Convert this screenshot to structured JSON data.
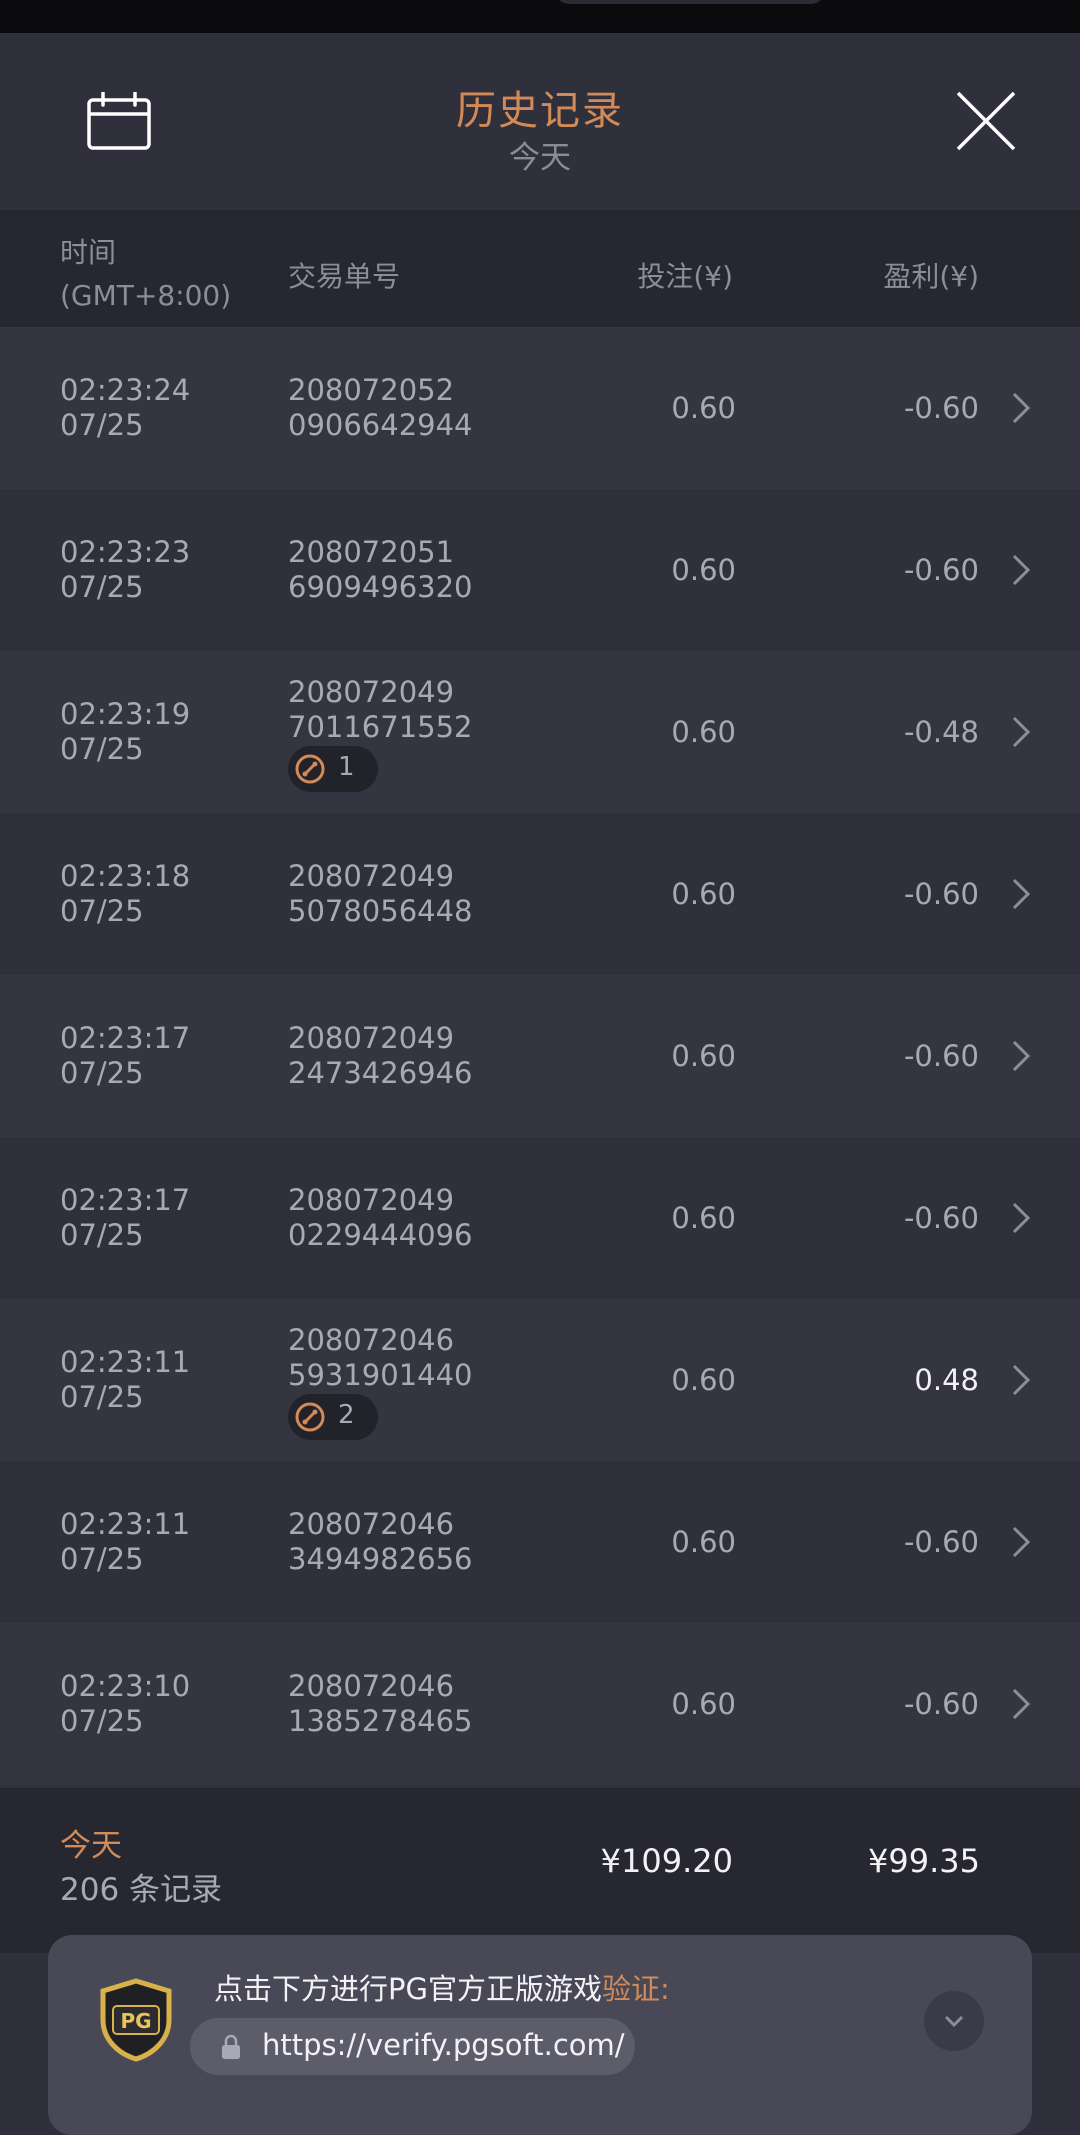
{
  "header": {
    "title": "历史记录",
    "subtitle": "今天"
  },
  "columns": {
    "time_line1": "时间",
    "time_line2": "(GMT+8:00)",
    "order": "交易单号",
    "bet": "投注(¥)",
    "profit": "盈利(¥)"
  },
  "rows": [
    {
      "time": "02:23:24",
      "date": "07/25",
      "order1": "208072052",
      "order2": "0906642944",
      "bet": "0.60",
      "profit": "-0.60",
      "badge": null
    },
    {
      "time": "02:23:23",
      "date": "07/25",
      "order1": "208072051",
      "order2": "6909496320",
      "bet": "0.60",
      "profit": "-0.60",
      "badge": null
    },
    {
      "time": "02:23:19",
      "date": "07/25",
      "order1": "208072049",
      "order2": "7011671552",
      "bet": "0.60",
      "profit": "-0.48",
      "badge": "1"
    },
    {
      "time": "02:23:18",
      "date": "07/25",
      "order1": "208072049",
      "order2": "5078056448",
      "bet": "0.60",
      "profit": "-0.60",
      "badge": null
    },
    {
      "time": "02:23:17",
      "date": "07/25",
      "order1": "208072049",
      "order2": "2473426946",
      "bet": "0.60",
      "profit": "-0.60",
      "badge": null
    },
    {
      "time": "02:23:17",
      "date": "07/25",
      "order1": "208072049",
      "order2": "0229444096",
      "bet": "0.60",
      "profit": "-0.60",
      "badge": null
    },
    {
      "time": "02:23:11",
      "date": "07/25",
      "order1": "208072046",
      "order2": "5931901440",
      "bet": "0.60",
      "profit": "0.48",
      "badge": "2"
    },
    {
      "time": "02:23:11",
      "date": "07/25",
      "order1": "208072046",
      "order2": "3494982656",
      "bet": "0.60",
      "profit": "-0.60",
      "badge": null
    },
    {
      "time": "02:23:10",
      "date": "07/25",
      "order1": "208072046",
      "order2": "1385278465",
      "bet": "0.60",
      "profit": "-0.60",
      "badge": null
    }
  ],
  "summary": {
    "label": "今天",
    "count": "206 条记录",
    "total_bet": "¥109.20",
    "total_profit": "¥99.35"
  },
  "banner": {
    "text": "点击下方进行PG官方正版游戏",
    "highlight": "验证:",
    "url": "https://verify.pgsoft.com/",
    "logo_text": "PG"
  },
  "icons": {
    "calendar": "calendar-icon",
    "close": "close-icon",
    "chevron": "chevron-right-icon",
    "badge": "free-spin-icon",
    "lock": "lock-icon",
    "expand": "chevron-down-icon"
  },
  "colors": {
    "accent": "#d28a56",
    "background": "#30303d",
    "text": "#a9a9b5"
  }
}
